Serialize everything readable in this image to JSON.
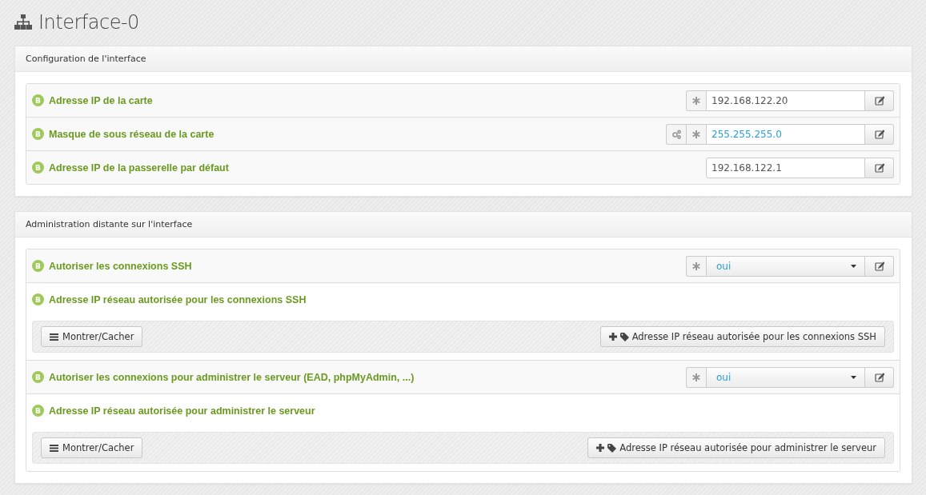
{
  "page": {
    "title": "Interface-0"
  },
  "panels": [
    {
      "title": "Configuration de l'interface",
      "rows": [
        {
          "kind": "field",
          "badge": "B",
          "label": "Adresse IP de la carte",
          "value": "192.168.122.20",
          "is_default": false,
          "mandatory": true,
          "auto": false
        },
        {
          "kind": "field",
          "badge": "B",
          "label": "Masque de sous réseau de la carte",
          "value": "255.255.255.0",
          "is_default": true,
          "mandatory": true,
          "auto": true
        },
        {
          "kind": "field",
          "badge": "B",
          "label": "Adresse IP de la passerelle par défaut",
          "value": "192.168.122.1",
          "is_default": false,
          "mandatory": false,
          "auto": false
        }
      ]
    },
    {
      "title": "Administration distante sur l'interface",
      "rows": [
        {
          "kind": "select",
          "badge": "B",
          "label": "Autoriser les connexions SSH",
          "value": "oui",
          "is_default": true,
          "mandatory": true,
          "auto": false
        },
        {
          "kind": "list",
          "badge": "B",
          "label": "Adresse IP réseau autorisée pour les connexions SSH",
          "toggle": "Montrer/Cacher",
          "add": "Adresse IP réseau autorisée pour les connexions SSH"
        },
        {
          "kind": "select",
          "badge": "B",
          "label": "Autoriser les connexions pour administrer le serveur (EAD, phpMyAdmin, ...)",
          "value": "oui",
          "is_default": true,
          "mandatory": true,
          "auto": false
        },
        {
          "kind": "list",
          "badge": "B",
          "label": "Adresse IP réseau autorisée pour administrer le serveur",
          "toggle": "Montrer/Cacher",
          "add": "Adresse IP réseau autorisée pour administrer le serveur"
        }
      ]
    }
  ]
}
